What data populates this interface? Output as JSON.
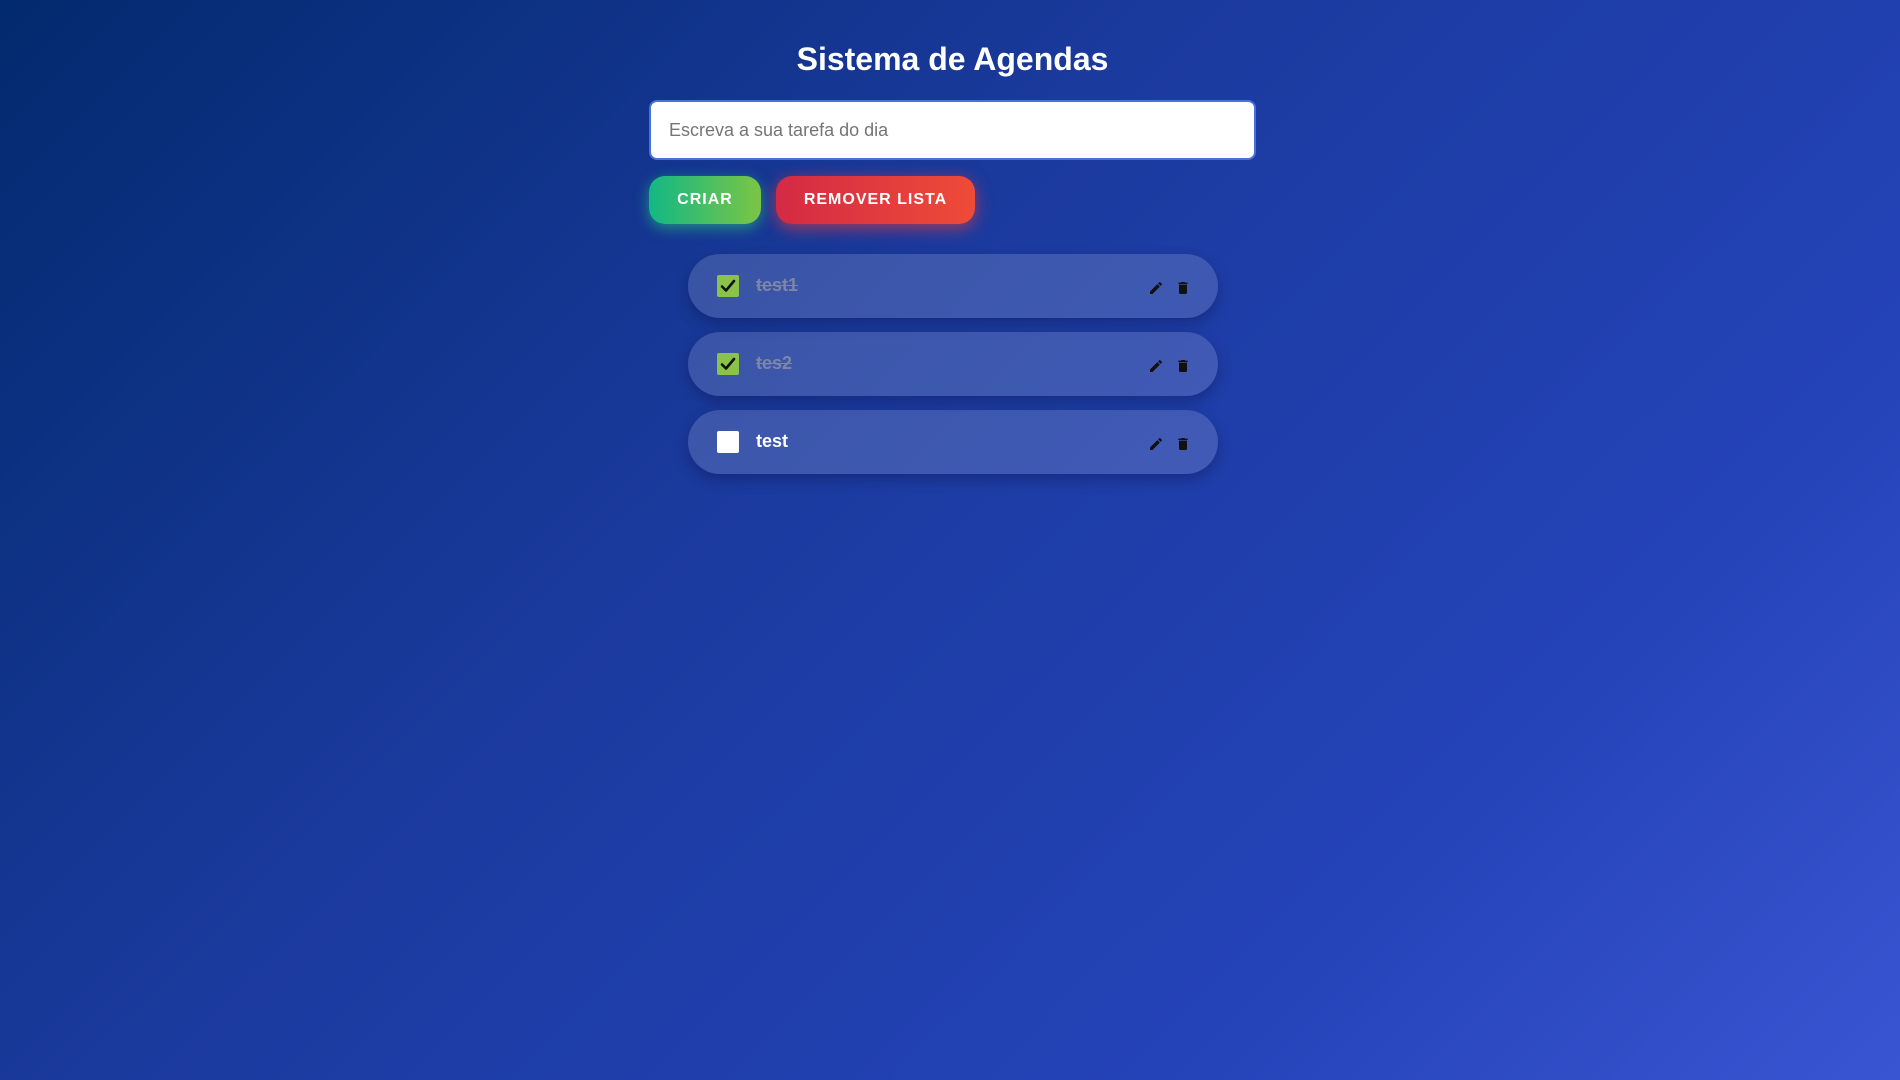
{
  "header": {
    "title": "Sistema de Agendas"
  },
  "form": {
    "placeholder": "Escreva a sua tarefa do dia",
    "value": "",
    "create_label": "CRIAR",
    "remove_list_label": "REMOVER LISTA"
  },
  "tasks": [
    {
      "text": "test1",
      "done": true
    },
    {
      "text": "tes2",
      "done": true
    },
    {
      "text": "test",
      "done": false
    }
  ],
  "icons": {
    "edit": "pencil-icon",
    "delete": "trash-icon",
    "check": "checkmark-icon"
  },
  "colors": {
    "create_start": "#12b886",
    "create_end": "#7cc545",
    "remove_start": "#d42a44",
    "remove_end": "#ef4b38",
    "checkbox_checked": "#8bc34a"
  }
}
